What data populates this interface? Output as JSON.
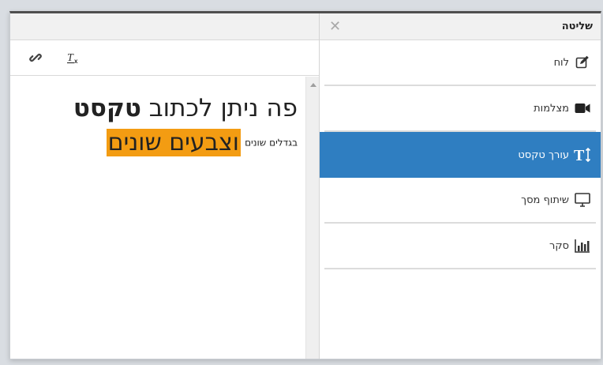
{
  "panel": {
    "title": "שליטה",
    "close_icon": "close-icon",
    "items": [
      {
        "label": "לוח",
        "icon": "edit-icon",
        "active": false
      },
      {
        "label": "מצלמות",
        "icon": "video-camera-icon",
        "active": false
      },
      {
        "label": "עורך טקסט",
        "icon": "text-height-icon",
        "active": true
      },
      {
        "label": "שיתוף מסך",
        "icon": "monitor-icon",
        "active": false
      },
      {
        "label": "סקר",
        "icon": "bar-chart-icon",
        "active": false
      }
    ]
  },
  "editor": {
    "toolbar": {
      "link_icon": "link-icon",
      "clear_format_icon": "clear-formatting-icon"
    },
    "line1": {
      "normal": "פה ניתן לכתוב ",
      "bold": "טקסט"
    },
    "line2": {
      "small": "בגדלים שונים",
      "highlight": "וצבעים שונים"
    }
  },
  "colors": {
    "active_bg": "#2f7ec1",
    "highlight": "#f39c12",
    "frame": "#4f4f4f"
  }
}
